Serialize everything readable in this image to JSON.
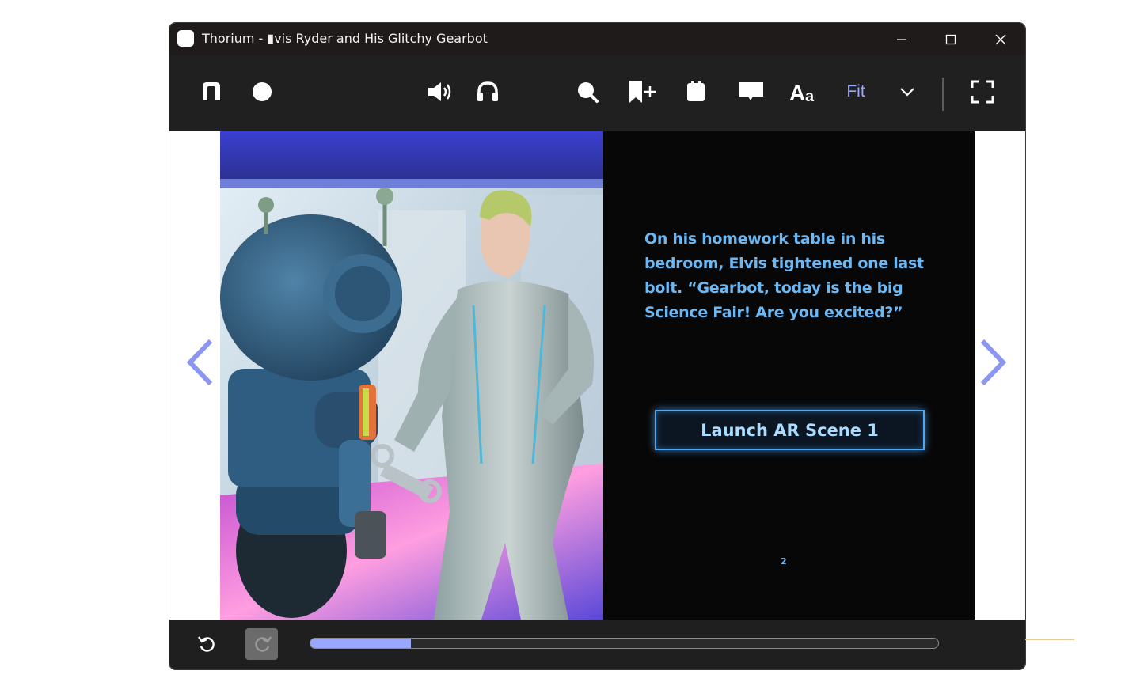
{
  "window": {
    "title": "Thorium - ▮vis Ryder and His Glitchy Gearbot"
  },
  "toolbar": {
    "fit_label": "Fit",
    "icons": [
      "library-icon",
      "info-icon",
      "read-aloud-icon",
      "audio-icon",
      "search-icon",
      "add-bookmark-icon",
      "bookmarks-icon",
      "annotations-icon",
      "text-settings-icon",
      "chevron-down-icon",
      "fullscreen-icon"
    ]
  },
  "page": {
    "story_text": "On his homework table in his bedroom, Elvis tightened one last bolt. “Gearbot, today is the big Science Fair! Are you excited?”",
    "ar_button_label": "Launch AR Scene 1",
    "page_number": "2"
  },
  "progress": {
    "fraction": 0.16
  },
  "colors": {
    "accent": "#9aa7ff",
    "story_text": "#6cb8f5",
    "titlebar": "#1f1b1b",
    "toolbar": "#202020"
  }
}
